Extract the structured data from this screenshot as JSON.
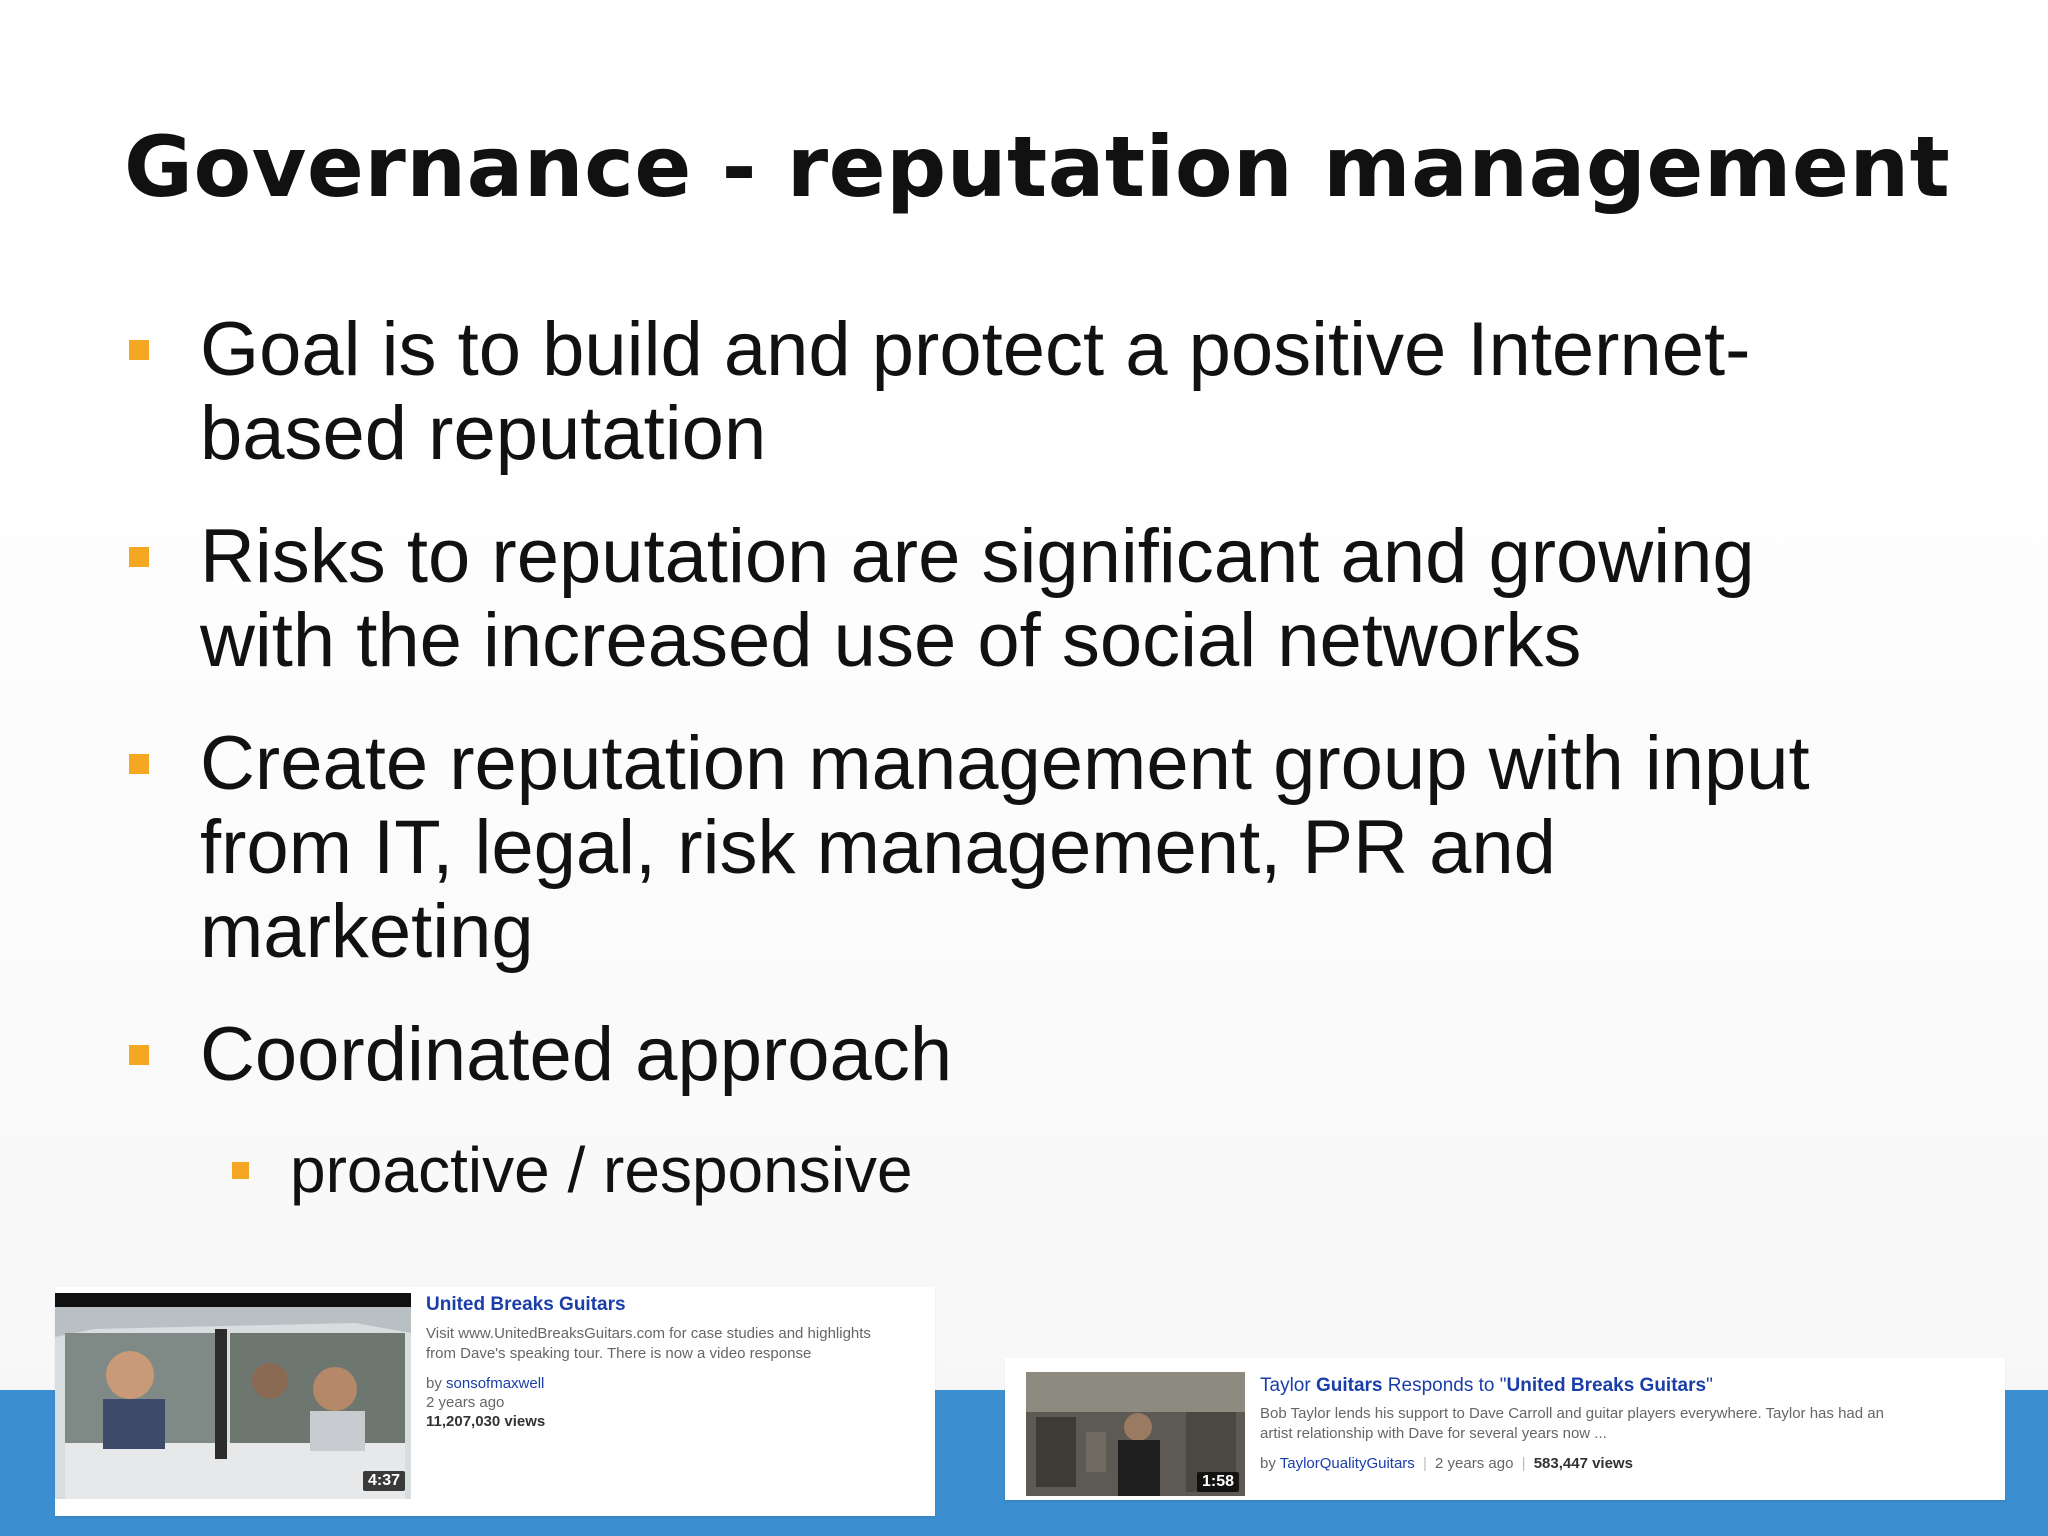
{
  "slide": {
    "title": "Governance - reputation management",
    "accent_color": "#f5a623",
    "band_color": "#3b8fd0"
  },
  "bullets": [
    {
      "lines": [
        "Goal is to build and protect a positive Internet-",
        "based reputation"
      ]
    },
    {
      "lines": [
        "Risks to reputation are significant and growing",
        "with the increased use of social networks"
      ]
    },
    {
      "lines": [
        "Create reputation management group with input",
        "from IT, legal, risk management, PR and",
        "marketing"
      ]
    },
    {
      "lines": [
        "Coordinated approach"
      ]
    }
  ],
  "sub_bullets": [
    {
      "text": "proactive / responsive"
    }
  ],
  "videos": [
    {
      "title": "United Breaks Guitars",
      "description_line1": "Visit www.UnitedBreaksGuitars.com for case studies and highlights",
      "description_line2": "from Dave's speaking tour. There is now a video response",
      "by_prefix": "by",
      "uploader": "sonsofmaxwell",
      "age": "2 years ago",
      "views": "11,207,030 views",
      "duration": "4:37"
    },
    {
      "title_prefix": "Taylor",
      "title_bold1": "Guitars",
      "title_mid": "Responds to \"",
      "title_bold2": "United Breaks Guitars",
      "title_end": "\"",
      "description_line1": "Bob Taylor lends his support to Dave Carroll and guitar players everywhere. Taylor has had an",
      "description_line2": "artist relationship with Dave for several years now ...",
      "by_prefix": "by",
      "uploader": "TaylorQualityGuitars",
      "separator": "|",
      "age": "2 years ago",
      "views": "583,447 views",
      "duration": "1:58"
    }
  ]
}
